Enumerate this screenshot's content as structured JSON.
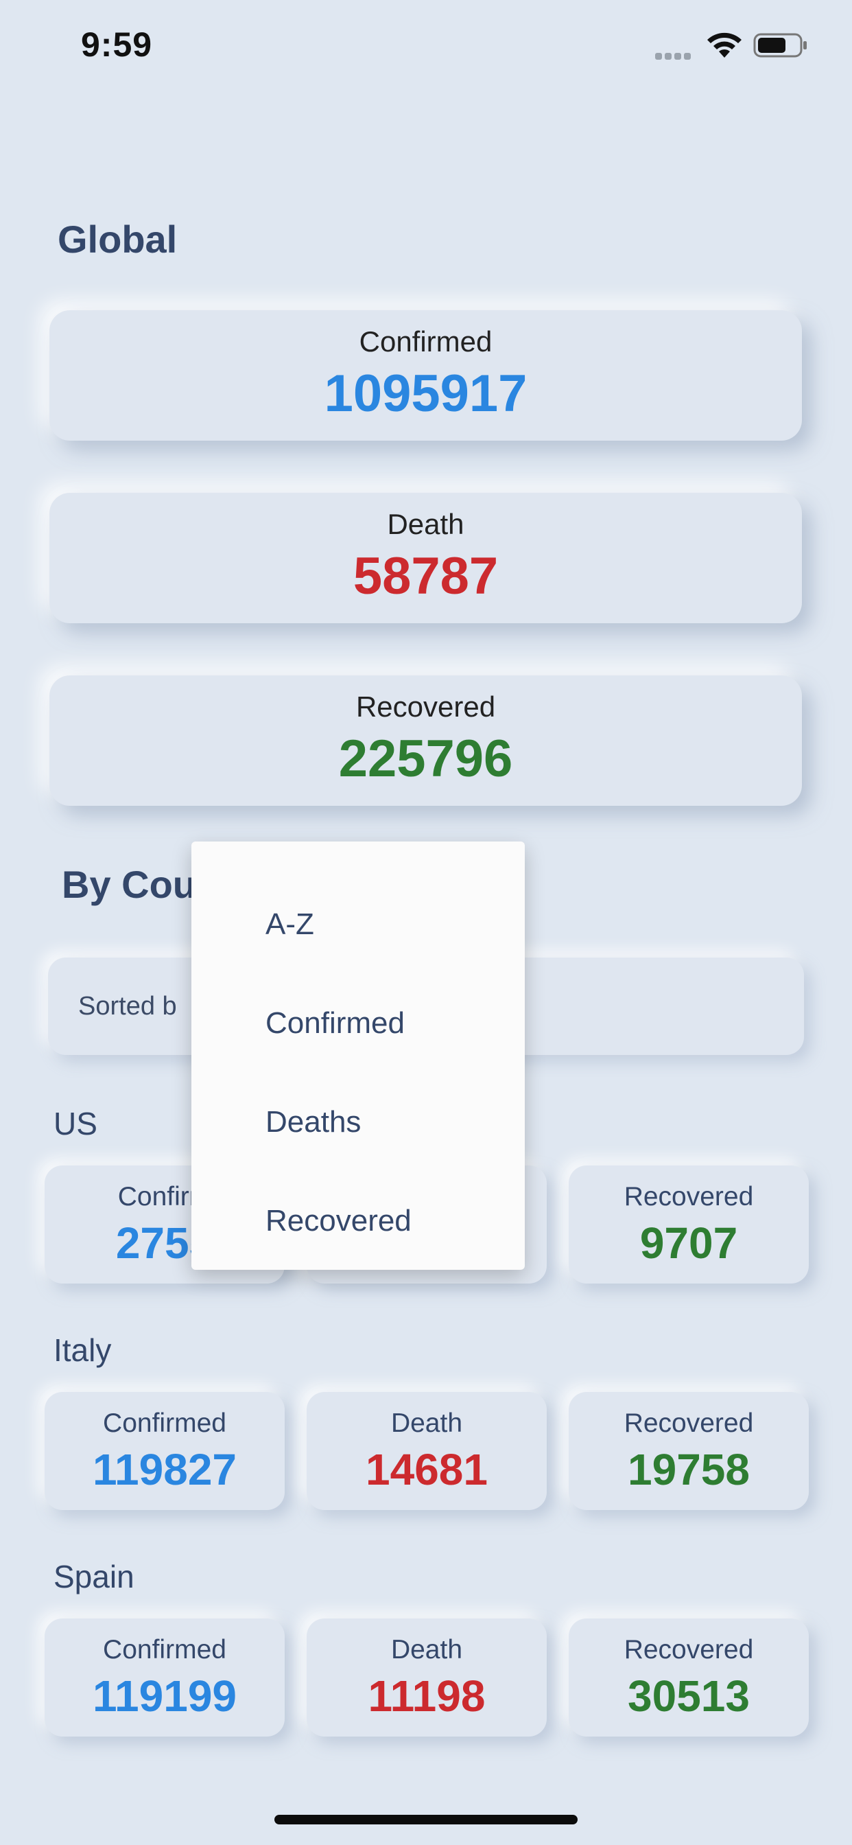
{
  "status_bar": {
    "time": "9:59"
  },
  "global": {
    "title": "Global",
    "cards": [
      {
        "label": "Confirmed",
        "value": "1095917",
        "color": "#2a86e0"
      },
      {
        "label": "Death",
        "value": "58787",
        "color": "#cc2a2e"
      },
      {
        "label": "Recovered",
        "value": "225796",
        "color": "#2e7d32"
      }
    ]
  },
  "by_country": {
    "title_visible": "By Cou",
    "sort_label_visible": "Sorted b",
    "countries": [
      {
        "name": "US",
        "confirmed_label": "Confirm",
        "confirmed_value": "2755",
        "recovered_label": "Recovered",
        "recovered_value": "9707"
      },
      {
        "name": "Italy",
        "confirmed_label": "Confirmed",
        "confirmed_value": "119827",
        "death_label": "Death",
        "death_value": "14681",
        "recovered_label": "Recovered",
        "recovered_value": "19758"
      },
      {
        "name": "Spain",
        "confirmed_label": "Confirmed",
        "confirmed_value": "119199",
        "death_label": "Death",
        "death_value": "11198",
        "recovered_label": "Recovered",
        "recovered_value": "30513"
      }
    ]
  },
  "sort_menu": {
    "options": [
      "A-Z",
      "Confirmed",
      "Deaths",
      "Recovered"
    ]
  },
  "icons": {
    "signal": "signal-icon",
    "wifi": "wifi-icon",
    "battery": "battery-icon"
  }
}
